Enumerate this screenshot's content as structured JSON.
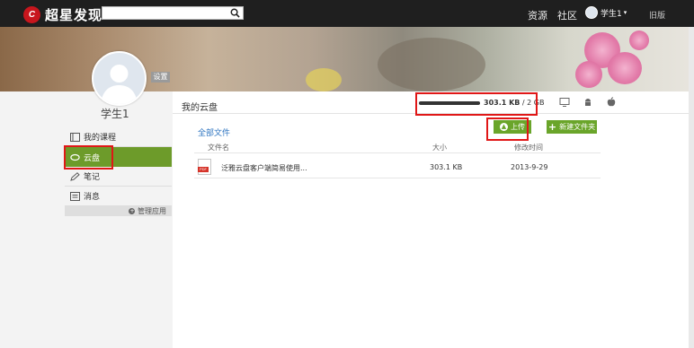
{
  "topbar": {
    "logo_mark": "chaoxing-logo-mark",
    "logo_text": "超星发现",
    "search_placeholder": "",
    "nav": [
      "资源",
      "社区"
    ],
    "user_name": "学生1",
    "user_caret": "▾",
    "old_version": "旧版"
  },
  "profile": {
    "settings_label": "设置",
    "name": "学生1"
  },
  "sidebar": {
    "items": [
      {
        "label": "我的课程",
        "icon": "course-icon"
      },
      {
        "label": "云盘",
        "icon": "cloud-icon",
        "active": true
      },
      {
        "label": "笔记",
        "icon": "pen-icon"
      },
      {
        "label": "消息",
        "icon": "message-icon"
      }
    ],
    "manage_label": "管理应用"
  },
  "main": {
    "title": "我的云盘",
    "quota_used": "303.1 KB",
    "quota_sep": " / ",
    "quota_total": "2 GB",
    "breadcrumb": "全部文件",
    "upload_label": "上传",
    "newfolder_label": "新建文件夹",
    "columns": {
      "name": "文件名",
      "size": "大小",
      "modified": "修改时间"
    },
    "files": [
      {
        "name": "泛雅云盘客户端简易使用...",
        "size": "303.1 KB",
        "modified": "2013-9-29",
        "type": "PDF"
      }
    ]
  },
  "colors": {
    "topbar": "#1f1f1f",
    "accent_green": "#6aa52a",
    "active_menu": "#6d9b2a",
    "link_blue": "#2d74c0",
    "highlight_red": "#e01717"
  }
}
